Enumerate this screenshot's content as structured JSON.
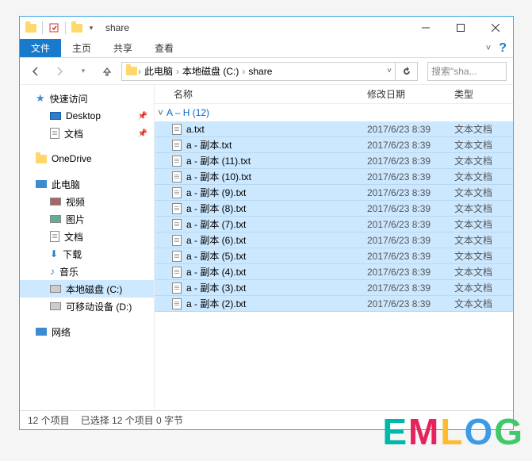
{
  "titlebar": {
    "title": "share"
  },
  "ribbon": {
    "file": "文件",
    "tabs": [
      "主页",
      "共享",
      "查看"
    ]
  },
  "breadcrumb": {
    "items": [
      "此电脑",
      "本地磁盘 (C:)",
      "share"
    ]
  },
  "search": {
    "placeholder": "搜索\"sha..."
  },
  "sidebar": {
    "quick": "快速访问",
    "desktop": "Desktop",
    "documents": "文档",
    "onedrive": "OneDrive",
    "thispc": "此电脑",
    "video": "视频",
    "pictures": "图片",
    "docs2": "文档",
    "downloads": "下载",
    "music": "音乐",
    "cdrive": "本地磁盘 (C:)",
    "ddrive": "可移动设备 (D:)",
    "network": "网络"
  },
  "columns": {
    "name": "名称",
    "date": "修改日期",
    "type": "类型"
  },
  "group": {
    "label": "A – H (12)"
  },
  "files": [
    {
      "name": "a.txt",
      "date": "2017/6/23 8:39",
      "type": "文本文档"
    },
    {
      "name": "a - 副本.txt",
      "date": "2017/6/23 8:39",
      "type": "文本文档"
    },
    {
      "name": "a - 副本 (11).txt",
      "date": "2017/6/23 8:39",
      "type": "文本文档"
    },
    {
      "name": "a - 副本 (10).txt",
      "date": "2017/6/23 8:39",
      "type": "文本文档"
    },
    {
      "name": "a - 副本 (9).txt",
      "date": "2017/6/23 8:39",
      "type": "文本文档"
    },
    {
      "name": "a - 副本 (8).txt",
      "date": "2017/6/23 8:39",
      "type": "文本文档"
    },
    {
      "name": "a - 副本 (7).txt",
      "date": "2017/6/23 8:39",
      "type": "文本文档"
    },
    {
      "name": "a - 副本 (6).txt",
      "date": "2017/6/23 8:39",
      "type": "文本文档"
    },
    {
      "name": "a - 副本 (5).txt",
      "date": "2017/6/23 8:39",
      "type": "文本文档"
    },
    {
      "name": "a - 副本 (4).txt",
      "date": "2017/6/23 8:39",
      "type": "文本文档"
    },
    {
      "name": "a - 副本 (3).txt",
      "date": "2017/6/23 8:39",
      "type": "文本文档"
    },
    {
      "name": "a - 副本 (2).txt",
      "date": "2017/6/23 8:39",
      "type": "文本文档"
    }
  ],
  "status": {
    "count": "12 个项目",
    "selection": "已选择 12 个项目 0 字节"
  },
  "watermark": "EMLOG"
}
